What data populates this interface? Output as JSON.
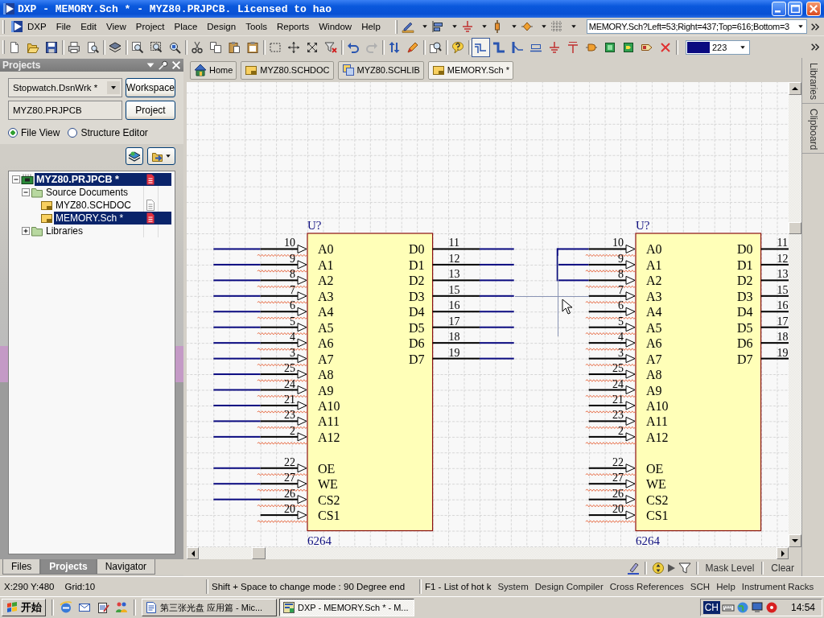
{
  "window": {
    "title": "DXP - MEMORY.Sch * - MYZ80.PRJPCB. Licensed to hao"
  },
  "menu": [
    "DXP",
    "File",
    "Edit",
    "View",
    "Project",
    "Place",
    "Design",
    "Tools",
    "Reports",
    "Window",
    "Help"
  ],
  "toolbar": {
    "document_location": "MEMORY.Sch?Left=53;Right=437;Top=616;Bottom=3",
    "wiring_tools": [
      {
        "selected": true
      },
      {
        "selected": false
      },
      {
        "selected": false
      },
      {
        "selected": false
      },
      {
        "selected": false
      },
      {
        "selected": false
      },
      {
        "selected": false
      },
      {
        "selected": false
      },
      {
        "selected": false
      },
      {
        "selected": false
      },
      {
        "selected": false
      }
    ],
    "color_picker": {
      "value": "223",
      "color": "#0a0a80"
    }
  },
  "projects_panel": {
    "title": "Projects",
    "workspace": "Stopwatch.DsnWrk *",
    "workspace_button": "Workspace",
    "project": "MYZ80.PRJPCB",
    "project_button": "Project",
    "views": [
      {
        "label": "File View",
        "selected": true
      },
      {
        "label": "Structure Editor",
        "selected": false
      }
    ],
    "tree": [
      {
        "label": "MYZ80.PRJPCB *",
        "kind": "project",
        "expanded": true,
        "selected": true,
        "modified": true,
        "children": [
          {
            "label": "Source Documents",
            "kind": "folder",
            "expanded": true,
            "selected": false,
            "children": [
              {
                "label": "MYZ80.SCHDOC",
                "kind": "document",
                "selected": false,
                "modified": false
              },
              {
                "label": "MEMORY.Sch *",
                "kind": "document",
                "selected": true,
                "modified": true
              }
            ]
          },
          {
            "label": "Libraries",
            "kind": "folder",
            "expanded": false,
            "selected": false
          }
        ]
      }
    ],
    "tabs": [
      {
        "label": "Files",
        "selected": false
      },
      {
        "label": "Projects",
        "selected": true
      },
      {
        "label": "Navigator",
        "selected": false
      }
    ]
  },
  "document_tabs": [
    {
      "label": "Home",
      "kind": "home",
      "selected": false
    },
    {
      "label": "MYZ80.SCHDOC",
      "kind": "schematic",
      "selected": false
    },
    {
      "label": "MYZ80.SCHLIB",
      "kind": "library",
      "selected": false
    },
    {
      "label": "MEMORY.Sch *",
      "kind": "schematic",
      "selected": true
    }
  ],
  "side_tabs": [
    "Libraries",
    "Clipboard"
  ],
  "schematic": {
    "components": [
      {
        "designator": "U?",
        "comment": "6264",
        "left_pin_groups": [
          [
            {
              "number": "10",
              "name": "A0",
              "wired": true,
              "flagged": true
            },
            {
              "number": "9",
              "name": "A1",
              "wired": true,
              "flagged": true
            },
            {
              "number": "8",
              "name": "A2",
              "wired": true,
              "flagged": true
            },
            {
              "number": "7",
              "name": "A3",
              "wired": true,
              "flagged": true
            },
            {
              "number": "6",
              "name": "A4",
              "wired": true,
              "flagged": true
            },
            {
              "number": "5",
              "name": "A5",
              "wired": true,
              "flagged": true
            },
            {
              "number": "4",
              "name": "A6",
              "wired": true,
              "flagged": true
            },
            {
              "number": "3",
              "name": "A7",
              "wired": true,
              "flagged": true
            },
            {
              "number": "25",
              "name": "A8",
              "wired": true,
              "flagged": true
            },
            {
              "number": "24",
              "name": "A9",
              "wired": true,
              "flagged": true
            },
            {
              "number": "21",
              "name": "A10",
              "wired": true,
              "flagged": true
            },
            {
              "number": "23",
              "name": "A11",
              "wired": true,
              "flagged": true
            },
            {
              "number": "2",
              "name": "A12",
              "wired": true,
              "flagged": true
            }
          ],
          [
            {
              "number": "22",
              "name": "OE",
              "wired": true,
              "flagged": true
            },
            {
              "number": "27",
              "name": "WE",
              "wired": true,
              "flagged": true
            },
            {
              "number": "26",
              "name": "CS2",
              "wired": true,
              "flagged": true
            },
            {
              "number": "20",
              "name": "CS1",
              "wired": false,
              "flagged": true
            }
          ]
        ],
        "right_pins": [
          {
            "number": "11",
            "name": "D0",
            "wired": true,
            "flagged": false
          },
          {
            "number": "12",
            "name": "D1",
            "wired": true,
            "flagged": false
          },
          {
            "number": "13",
            "name": "D2",
            "wired": true,
            "flagged": false
          },
          {
            "number": "15",
            "name": "D3",
            "wired": true,
            "flagged": false
          },
          {
            "number": "16",
            "name": "D4",
            "wired": true,
            "flagged": false
          },
          {
            "number": "17",
            "name": "D5",
            "wired": true,
            "flagged": false
          },
          {
            "number": "18",
            "name": "D6",
            "wired": true,
            "flagged": false
          },
          {
            "number": "19",
            "name": "D7",
            "wired": true,
            "flagged": false
          }
        ]
      },
      {
        "designator": "U?",
        "comment": "6264",
        "left_pin_groups": [
          [
            {
              "number": "10",
              "name": "A0",
              "wired": true,
              "flagged": true
            },
            {
              "number": "9",
              "name": "A1",
              "wired": true,
              "flagged": true
            },
            {
              "number": "8",
              "name": "A2",
              "wired": true,
              "flagged": true
            },
            {
              "number": "7",
              "name": "A3",
              "wired": false,
              "flagged": true
            },
            {
              "number": "6",
              "name": "A4",
              "wired": false,
              "flagged": true
            },
            {
              "number": "5",
              "name": "A5",
              "wired": false,
              "flagged": true
            },
            {
              "number": "4",
              "name": "A6",
              "wired": false,
              "flagged": true
            },
            {
              "number": "3",
              "name": "A7",
              "wired": false,
              "flagged": true
            },
            {
              "number": "25",
              "name": "A8",
              "wired": false,
              "flagged": true
            },
            {
              "number": "24",
              "name": "A9",
              "wired": false,
              "flagged": true
            },
            {
              "number": "21",
              "name": "A10",
              "wired": false,
              "flagged": true
            },
            {
              "number": "23",
              "name": "A11",
              "wired": false,
              "flagged": true
            },
            {
              "number": "2",
              "name": "A12",
              "wired": false,
              "flagged": true
            }
          ],
          [
            {
              "number": "22",
              "name": "OE",
              "wired": false,
              "flagged": true
            },
            {
              "number": "27",
              "name": "WE",
              "wired": false,
              "flagged": true
            },
            {
              "number": "26",
              "name": "CS2",
              "wired": false,
              "flagged": true
            },
            {
              "number": "20",
              "name": "CS1",
              "wired": false,
              "flagged": true
            }
          ]
        ],
        "right_pins": [
          {
            "number": "11",
            "name": "D0",
            "wired": false,
            "flagged": false
          },
          {
            "number": "12",
            "name": "D1",
            "wired": false,
            "flagged": false
          },
          {
            "number": "13",
            "name": "D2",
            "wired": false,
            "flagged": false
          },
          {
            "number": "15",
            "name": "D3",
            "wired": false,
            "flagged": false
          },
          {
            "number": "16",
            "name": "D4",
            "wired": false,
            "flagged": false
          },
          {
            "number": "17",
            "name": "D5",
            "wired": false,
            "flagged": false
          },
          {
            "number": "18",
            "name": "D6",
            "wired": false,
            "flagged": false
          },
          {
            "number": "19",
            "name": "D7",
            "wired": false,
            "flagged": false
          }
        ]
      }
    ]
  },
  "mask_bar": {
    "mask_level": "Mask Level",
    "clear": "Clear"
  },
  "status_bar": {
    "coordinates": "X:290 Y:480",
    "grid": "Grid:10",
    "mode_hint": "Shift + Space to change mode : 90 Degree end",
    "help_hint": "F1 - List of hot k",
    "panels": [
      "System",
      "Design Compiler",
      "Cross References",
      "SCH",
      "Help",
      "Instrument Racks"
    ]
  },
  "taskbar": {
    "start": "开始",
    "tasks": [
      {
        "label": "第三张光盘 应用篇 - Mic...",
        "kind": "document",
        "selected": false
      },
      {
        "label": "DXP - MEMORY.Sch * - M...",
        "kind": "app",
        "selected": true
      }
    ],
    "language": "CH",
    "clock": "14:54"
  }
}
